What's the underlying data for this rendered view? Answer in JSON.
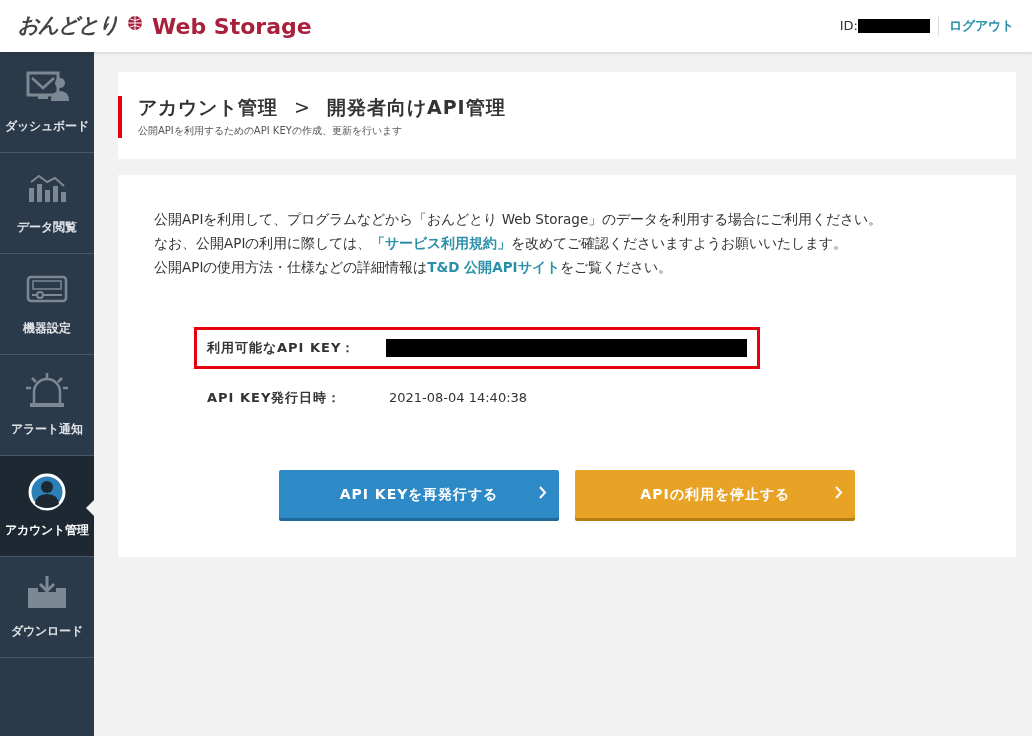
{
  "header": {
    "logo_text": "おんどとり",
    "logo_product": "Web Storage",
    "id_label": "ID:",
    "id_redacted": true,
    "logout": "ログアウト"
  },
  "sidebar": {
    "items": [
      {
        "label": "ダッシュボード",
        "selected": false
      },
      {
        "label": "データ閲覧",
        "selected": false
      },
      {
        "label": "機器設定",
        "selected": false
      },
      {
        "label": "アラート通知",
        "selected": false
      },
      {
        "label": "アカウント管理",
        "selected": true
      },
      {
        "label": "ダウンロード",
        "selected": false
      }
    ]
  },
  "page_header": {
    "breadcrumb": [
      "アカウント管理",
      "開発者向けAPI管理"
    ],
    "separator": ">",
    "subtitle": "公開APIを利用するためのAPI KEYの作成、更新を行います"
  },
  "intro": [
    [
      {
        "text": "公開APIを利用して、プログラムなどから「おんどとり Web Storage」のデータを利用する場合にご利用ください。",
        "link": false
      }
    ],
    [
      {
        "text": "なお、公開APIの利用に際しては、",
        "link": false
      },
      {
        "text": "「サービス利用規約」",
        "link": true
      },
      {
        "text": "を改めてご確認くださいますようお願いいたします。",
        "link": false
      }
    ],
    [
      {
        "text": "公開APIの使用方法・仕様などの詳細情報は",
        "link": false
      },
      {
        "text": "T&D 公開APIサイト",
        "link": true
      },
      {
        "text": "をご覧ください。",
        "link": false
      }
    ]
  ],
  "fields": [
    {
      "label": "利用可能なAPI KEY：",
      "redacted": true,
      "highlighted": true
    },
    {
      "label": "API KEY発行日時：",
      "value": "2021-08-04 14:40:38",
      "highlighted": false
    }
  ],
  "buttons": [
    {
      "label": "API KEYを再発行する",
      "kind": "primary"
    },
    {
      "label": "APIの利用を停止する",
      "kind": "warning"
    }
  ]
}
